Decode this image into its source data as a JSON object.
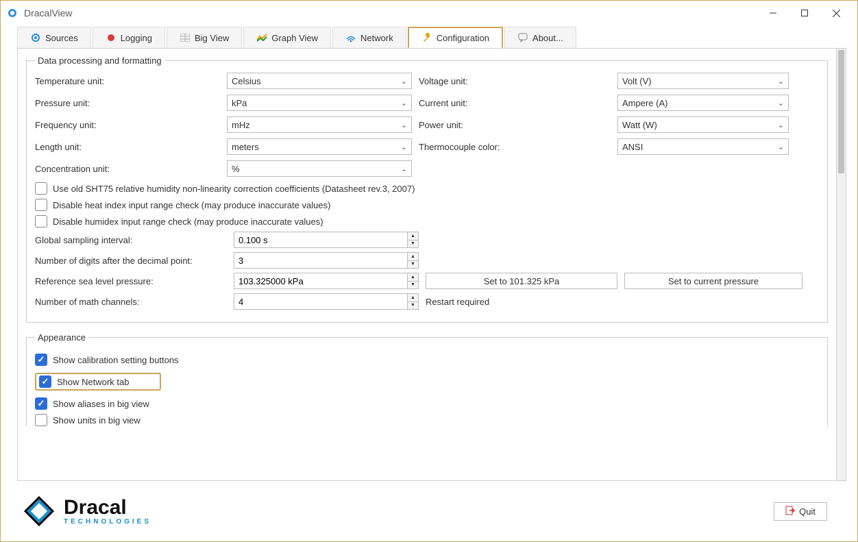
{
  "window": {
    "title": "DracalView"
  },
  "tabs": {
    "sources": "Sources",
    "logging": "Logging",
    "bigview": "Big View",
    "graphview": "Graph View",
    "network": "Network",
    "configuration": "Configuration",
    "about": "About..."
  },
  "section_data": {
    "legend": "Data processing and formatting",
    "temp_label": "Temperature unit:",
    "temp_value": "Celsius",
    "voltage_label": "Voltage unit:",
    "voltage_value": "Volt (V)",
    "pressure_label": "Pressure unit:",
    "pressure_value": "kPa",
    "current_label": "Current unit:",
    "current_value": "Ampere (A)",
    "freq_label": "Frequency unit:",
    "freq_value": "mHz",
    "power_label": "Power unit:",
    "power_value": "Watt (W)",
    "length_label": "Length unit:",
    "length_value": "meters",
    "thermo_label": "Thermocouple color:",
    "thermo_value": "ANSI",
    "conc_label": "Concentration unit:",
    "conc_value": "%",
    "chk_sht75": "Use old SHT75 relative humidity non-linearity correction coefficients (Datasheet rev.3, 2007)",
    "chk_heat": "Disable heat index input range check (may produce inaccurate values)",
    "chk_humidex": "Disable humidex input range check (may produce inaccurate values)",
    "sampling_label": "Global sampling interval:",
    "sampling_value": "0.100 s",
    "digits_label": "Number of digits after the decimal point:",
    "digits_value": "3",
    "refpress_label": "Reference sea level pressure:",
    "refpress_value": "103.325000 kPa",
    "btn_set_default": "Set to 101.325 kPa",
    "btn_set_current": "Set to current pressure",
    "math_label": "Number of math channels:",
    "math_value": "4",
    "restart_note": "Restart required"
  },
  "section_appearance": {
    "legend": "Appearance",
    "chk_calib": "Show calibration setting buttons",
    "chk_network": "Show Network tab",
    "chk_aliases": "Show aliases in big view",
    "chk_units": "Show units in big view"
  },
  "footer": {
    "logo_main": "Dracal",
    "logo_sub": "TECHNOLOGIES",
    "quit": "Quit"
  }
}
